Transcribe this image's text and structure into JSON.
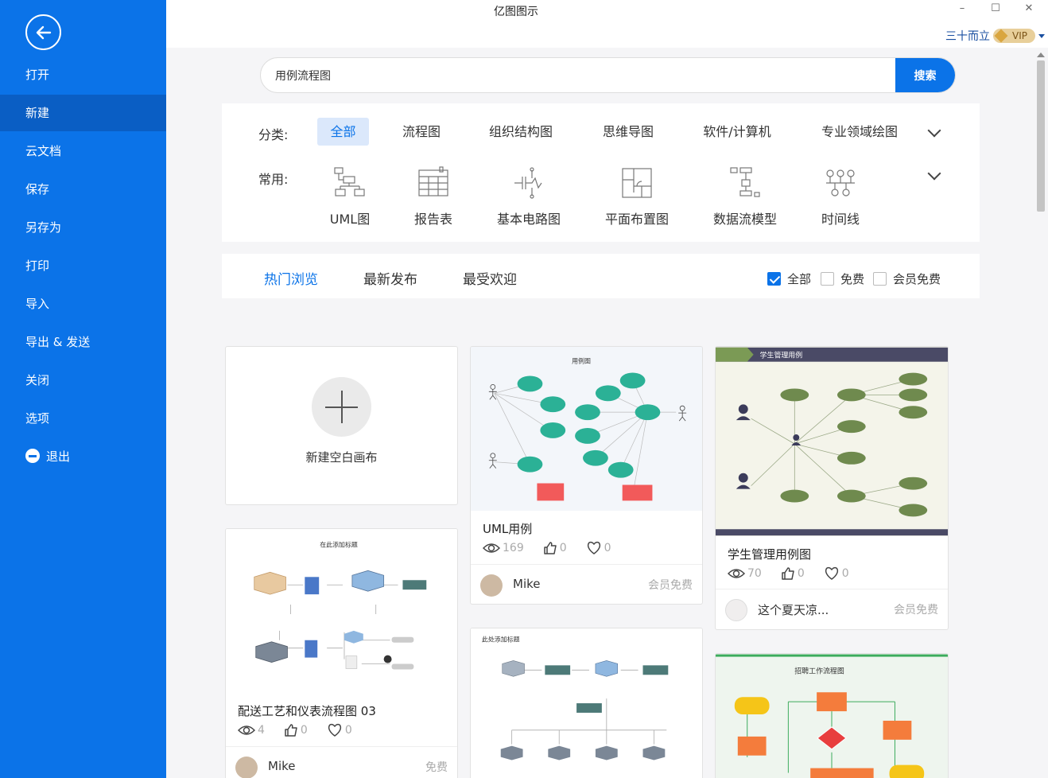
{
  "app": {
    "title": "亿图图示"
  },
  "window": {
    "minimize": "–",
    "maximize": "☐",
    "close": "✕"
  },
  "user": {
    "name": "三十而立",
    "vip_label": "VIP"
  },
  "sidebar": {
    "items": [
      {
        "label": "打开"
      },
      {
        "label": "新建"
      },
      {
        "label": "云文档"
      },
      {
        "label": "保存"
      },
      {
        "label": "另存为"
      },
      {
        "label": "打印"
      },
      {
        "label": "导入"
      },
      {
        "label": "导出 & 发送"
      },
      {
        "label": "关闭"
      },
      {
        "label": "选项"
      },
      {
        "label": "退出"
      }
    ],
    "active_index": 1
  },
  "search": {
    "value": "用例流程图",
    "button_label": "搜索"
  },
  "filters": {
    "category_label": "分类:",
    "categories": [
      "全部",
      "流程图",
      "组织结构图",
      "思维导图",
      "软件/计算机",
      "专业领域绘图"
    ],
    "common_label": "常用:",
    "common": [
      "UML图",
      "报告表",
      "基本电路图",
      "平面布置图",
      "数据流模型",
      "时间线"
    ]
  },
  "tabs": {
    "items": [
      "热门浏览",
      "最新发布",
      "最受欢迎"
    ],
    "checkboxes": [
      {
        "label": "全部",
        "checked": true
      },
      {
        "label": "免费",
        "checked": false
      },
      {
        "label": "会员免费",
        "checked": false
      }
    ]
  },
  "new_canvas": {
    "label": "新建空白画布"
  },
  "cards": [
    {
      "thumb_title": "用例图",
      "title": "UML用例",
      "views": "169",
      "likes": "0",
      "favs": "0",
      "author": "Mike",
      "price": "会员免费"
    },
    {
      "thumb_title": "学生管理用例",
      "title": "学生管理用例图",
      "views": "70",
      "likes": "0",
      "favs": "0",
      "author": "这个夏天凉...",
      "price": "会员免费"
    },
    {
      "thumb_title": "在此添加标题",
      "title": "配送工艺和仪表流程图 03",
      "views": "4",
      "likes": "0",
      "favs": "0",
      "author": "Mike",
      "price": "免费"
    },
    {
      "thumb_title": "此处添加标题"
    },
    {
      "thumb_title": "招聘工作流程图"
    }
  ]
}
